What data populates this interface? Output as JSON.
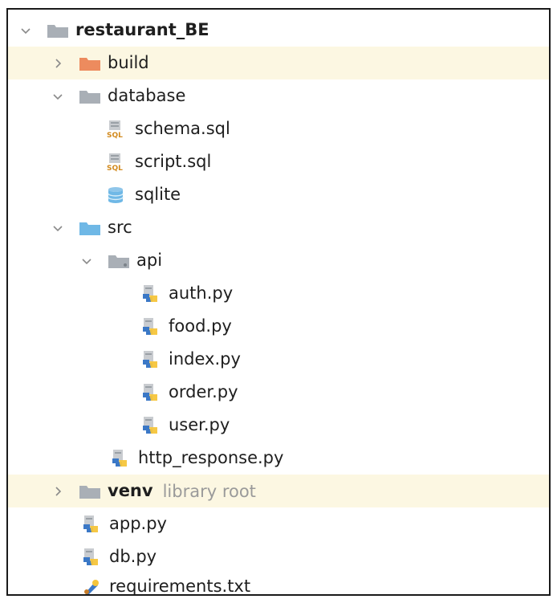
{
  "tree": [
    {
      "name": "restaurant_BE",
      "icon": "folder-icon",
      "expanded": true,
      "bold": true
    },
    {
      "name": "build",
      "icon": "excluded-folder-icon",
      "expanded": false,
      "highlighted": true
    },
    {
      "name": "database",
      "icon": "folder-icon",
      "expanded": true
    },
    {
      "name": "schema.sql",
      "icon": "sql-file-icon"
    },
    {
      "name": "script.sql",
      "icon": "sql-file-icon"
    },
    {
      "name": "sqlite",
      "icon": "database-icon"
    },
    {
      "name": "src",
      "icon": "source-folder-icon",
      "expanded": true
    },
    {
      "name": "api",
      "icon": "package-icon",
      "expanded": true
    },
    {
      "name": "auth.py",
      "icon": "python-file-icon"
    },
    {
      "name": "food.py",
      "icon": "python-file-icon"
    },
    {
      "name": "index.py",
      "icon": "python-file-icon"
    },
    {
      "name": "order.py",
      "icon": "python-file-icon"
    },
    {
      "name": "user.py",
      "icon": "python-file-icon"
    },
    {
      "name": "http_response.py",
      "icon": "python-file-icon"
    },
    {
      "name": "venv",
      "hint": "library root",
      "icon": "folder-icon",
      "expanded": false,
      "highlighted": true,
      "bold": true
    },
    {
      "name": "app.py",
      "icon": "python-file-icon"
    },
    {
      "name": "db.py",
      "icon": "python-file-icon"
    },
    {
      "name": "requirements.txt",
      "icon": "requirements-file-icon"
    }
  ],
  "colors": {
    "highlight": "#fcf7e2",
    "folder": "#a9afb6",
    "excluded_folder": "#ed8b5e",
    "source_folder": "#6fb8e6",
    "python_blue": "#3b78c6",
    "python_yellow": "#f5c53b",
    "hint": "#9a9a9a"
  }
}
